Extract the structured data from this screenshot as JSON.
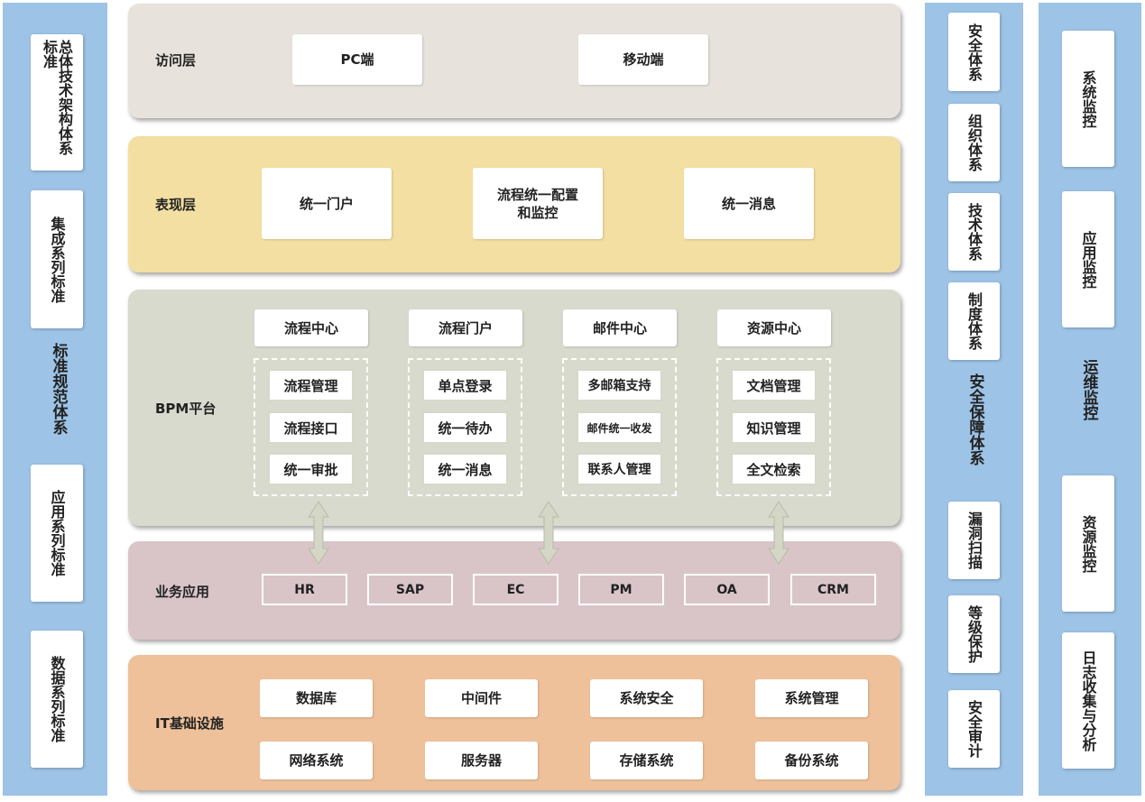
{
  "left_column": {
    "items": [
      "总体技术架构体系标准",
      "集成系列标准",
      "应用系列标准",
      "数据系列标准"
    ],
    "center_label": "标准规范体系"
  },
  "layers": {
    "access": {
      "label": "访问层",
      "items": [
        "PC端",
        "移动端"
      ]
    },
    "presentation": {
      "label": "表现层",
      "items": [
        "统一门户",
        "流程统一配置和监控",
        "统一消息"
      ]
    },
    "bpm": {
      "label": "BPM平台",
      "groups": [
        {
          "title": "流程中心",
          "items": [
            "流程管理",
            "流程接口",
            "统一审批"
          ]
        },
        {
          "title": "流程门户",
          "items": [
            "单点登录",
            "统一待办",
            "统一消息"
          ]
        },
        {
          "title": "邮件中心",
          "items": [
            "多邮箱支持",
            "邮件统一收发",
            "联系人管理"
          ]
        },
        {
          "title": "资源中心",
          "items": [
            "文档管理",
            "知识管理",
            "全文检索"
          ]
        }
      ]
    },
    "business": {
      "label": "业务应用",
      "items": [
        "HR",
        "SAP",
        "EC",
        "PM",
        "OA",
        "CRM"
      ]
    },
    "infra": {
      "label": "IT基础设施",
      "items": [
        "数据库",
        "中间件",
        "系统安全",
        "系统管理",
        "网络系统",
        "服务器",
        "存储系统",
        "备份系统"
      ]
    }
  },
  "security_column": {
    "top_items": [
      "安全体系",
      "组织体系",
      "技术体系",
      "制度体系"
    ],
    "center_label": "安全保障体系",
    "bottom_items": [
      "漏洞扫描",
      "等级保护",
      "安全审计"
    ]
  },
  "ops_column": {
    "top_items": [
      "系统监控",
      "应用监控"
    ],
    "center_label": "运维监控",
    "bottom_items": [
      "资源监控",
      "日志收集与分析"
    ]
  },
  "colors": {
    "side_bg": "#9dc3e6",
    "access_bg": "#e7e2db",
    "presentation_bg": "#f3dfa2",
    "bpm_bg": "#d8dacd",
    "business_bg": "#d9c5c8",
    "infra_bg": "#eec19a",
    "arrow_fill": "#d4d6c6"
  }
}
